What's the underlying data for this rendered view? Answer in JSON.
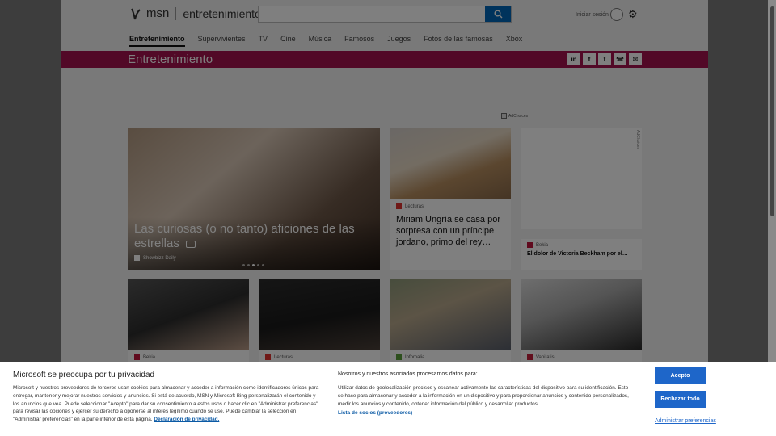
{
  "header": {
    "logo_text": "msn",
    "section": "entretenimiento",
    "search_placeholder": "",
    "signin_label": "Iniciar sesión"
  },
  "nav": {
    "items": [
      {
        "label": "Entretenimiento"
      },
      {
        "label": "Supervivientes"
      },
      {
        "label": "TV"
      },
      {
        "label": "Cine"
      },
      {
        "label": "Música"
      },
      {
        "label": "Famosos"
      },
      {
        "label": "Juegos"
      },
      {
        "label": "Fotos de las famosas"
      },
      {
        "label": "Xbox"
      }
    ]
  },
  "banner": {
    "title": "Entretenimiento",
    "share_icons": [
      "linkedin-icon",
      "facebook-icon",
      "twitter-icon",
      "whatsapp-icon",
      "mail-icon"
    ]
  },
  "adchoices_label": "AdChoices",
  "hero": {
    "title": "Las curiosas (o no tanto) aficiones de las estrellas",
    "source": "Showbizz Daily"
  },
  "cards": [
    {
      "source": "Lecturas",
      "title": "Miriam Ungría se casa por sorpresa con un príncipe jordano, primo del rey…",
      "source_color": "#e0322f"
    },
    {
      "source": "Bekia",
      "title": "El dolor de Victoria Beckham por el…",
      "source_color": "#c0143c"
    },
    {
      "source": "Bekia",
      "title": "",
      "source_color": "#c0143c"
    },
    {
      "source": "Lecturas",
      "title": "",
      "source_color": "#e0322f"
    },
    {
      "source": "Infomalia",
      "title": "",
      "source_color": "#5a9e3a"
    },
    {
      "source": "Vanitatis",
      "title": "",
      "source_color": "#c41e3a"
    }
  ],
  "ad_label": "AdChoices",
  "cookie": {
    "title": "Microsoft se preocupa por tu privacidad",
    "body": "Microsoft y nuestros proveedores de terceros usan cookies para almacenar y acceder a información como identificadores únicos para entregar, mantener y mejorar nuestros servicios y anuncios. Si está de acuerdo, MSN y Microsoft Bing personalizarán el contenido y los anuncios que vea. Puede seleccionar \"Acepto\" para dar su consentimiento a estos usos o hacer clic en \"Administrar preferencias\" para revisar las opciones y ejercer su derecho a oponerse al interés legítimo cuando se use. Puede cambiar la selección en \"Administrar preferencias\" en la parte inferior de esta página.",
    "privacy_link": "Declaración de privacidad.",
    "partners_title": "Nosotros y nuestros asociados procesamos datos para:",
    "partners_body": "Utilizar datos de geolocalización precisos y escanear activamente las características del dispositivo para su identificación. Esto se hace para almacenar y acceder a la información en un dispositivo y para proporcionar anuncios y contenido personalizados, medir los anuncios y contenido, obtener información del público y desarrollar productos.",
    "partners_link": "Lista de socios (proveedores)",
    "accept": "Acepto",
    "reject": "Rechazar todo",
    "manage": "Administrar preferencias"
  }
}
